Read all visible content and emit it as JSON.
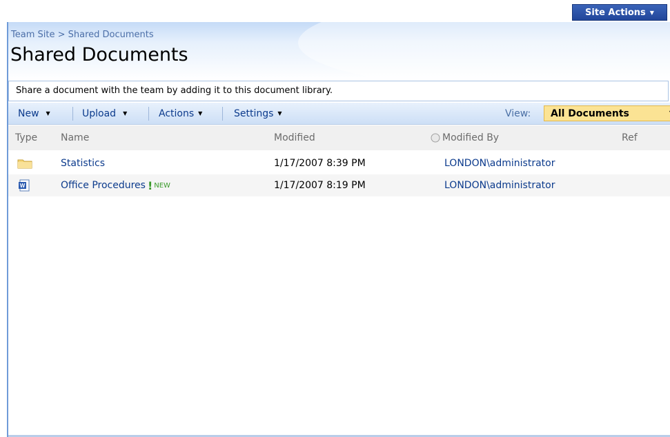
{
  "site_actions": {
    "label": "Site Actions"
  },
  "breadcrumb": {
    "site": "Team Site",
    "separator": ">",
    "current": "Shared Documents"
  },
  "page_title": "Shared Documents",
  "description": "Share a document with the team by adding it to this document library.",
  "toolbar": {
    "new_label": "New",
    "upload_label": "Upload",
    "actions_label": "Actions",
    "settings_label": "Settings",
    "view_label": "View:",
    "view_value": "All Documents"
  },
  "columns": {
    "type": "Type",
    "name": "Name",
    "modified": "Modified",
    "modified_by": "Modified By",
    "ref": "Ref"
  },
  "rows": [
    {
      "icon": "folder-icon",
      "name": "Statistics",
      "modified": "1/17/2007 8:39 PM",
      "modified_by": "LONDON\\administrator",
      "is_new": false
    },
    {
      "icon": "word-document-icon",
      "name": "Office Procedures",
      "modified": "1/17/2007 8:19 PM",
      "modified_by": "LONDON\\administrator",
      "is_new": true,
      "new_label": "NEW"
    }
  ],
  "colors": {
    "accent": "#21469a",
    "link": "#0b3a8c",
    "view_selector": "#fbe394",
    "new_badge": "#3a9a2a"
  }
}
